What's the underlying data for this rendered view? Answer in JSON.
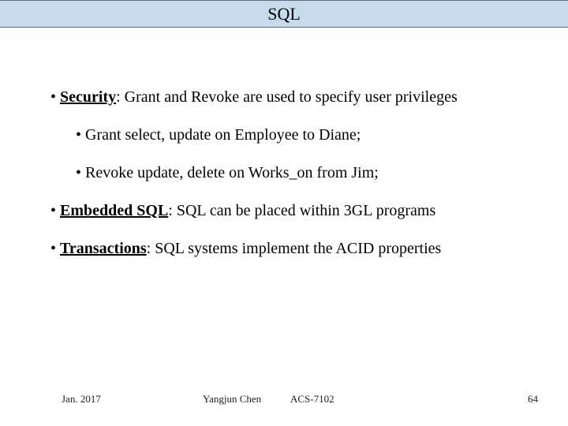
{
  "title": "SQL",
  "bullets": {
    "b1_strong": "Security",
    "b1_rest": ": Grant and Revoke are used to specify user privileges",
    "b1a": "Grant select, update on Employee to Diane;",
    "b1b": "Revoke update, delete on Works_on from Jim;",
    "b2_strong": "Embedded SQL",
    "b2_rest": ": SQL can be placed within 3GL programs",
    "b3_strong": "Transactions",
    "b3_rest": ": SQL systems implement the ACID properties"
  },
  "footer": {
    "date": "Jan. 2017",
    "author": "Yangjun Chen",
    "course": "ACS-7102",
    "page": "64"
  }
}
